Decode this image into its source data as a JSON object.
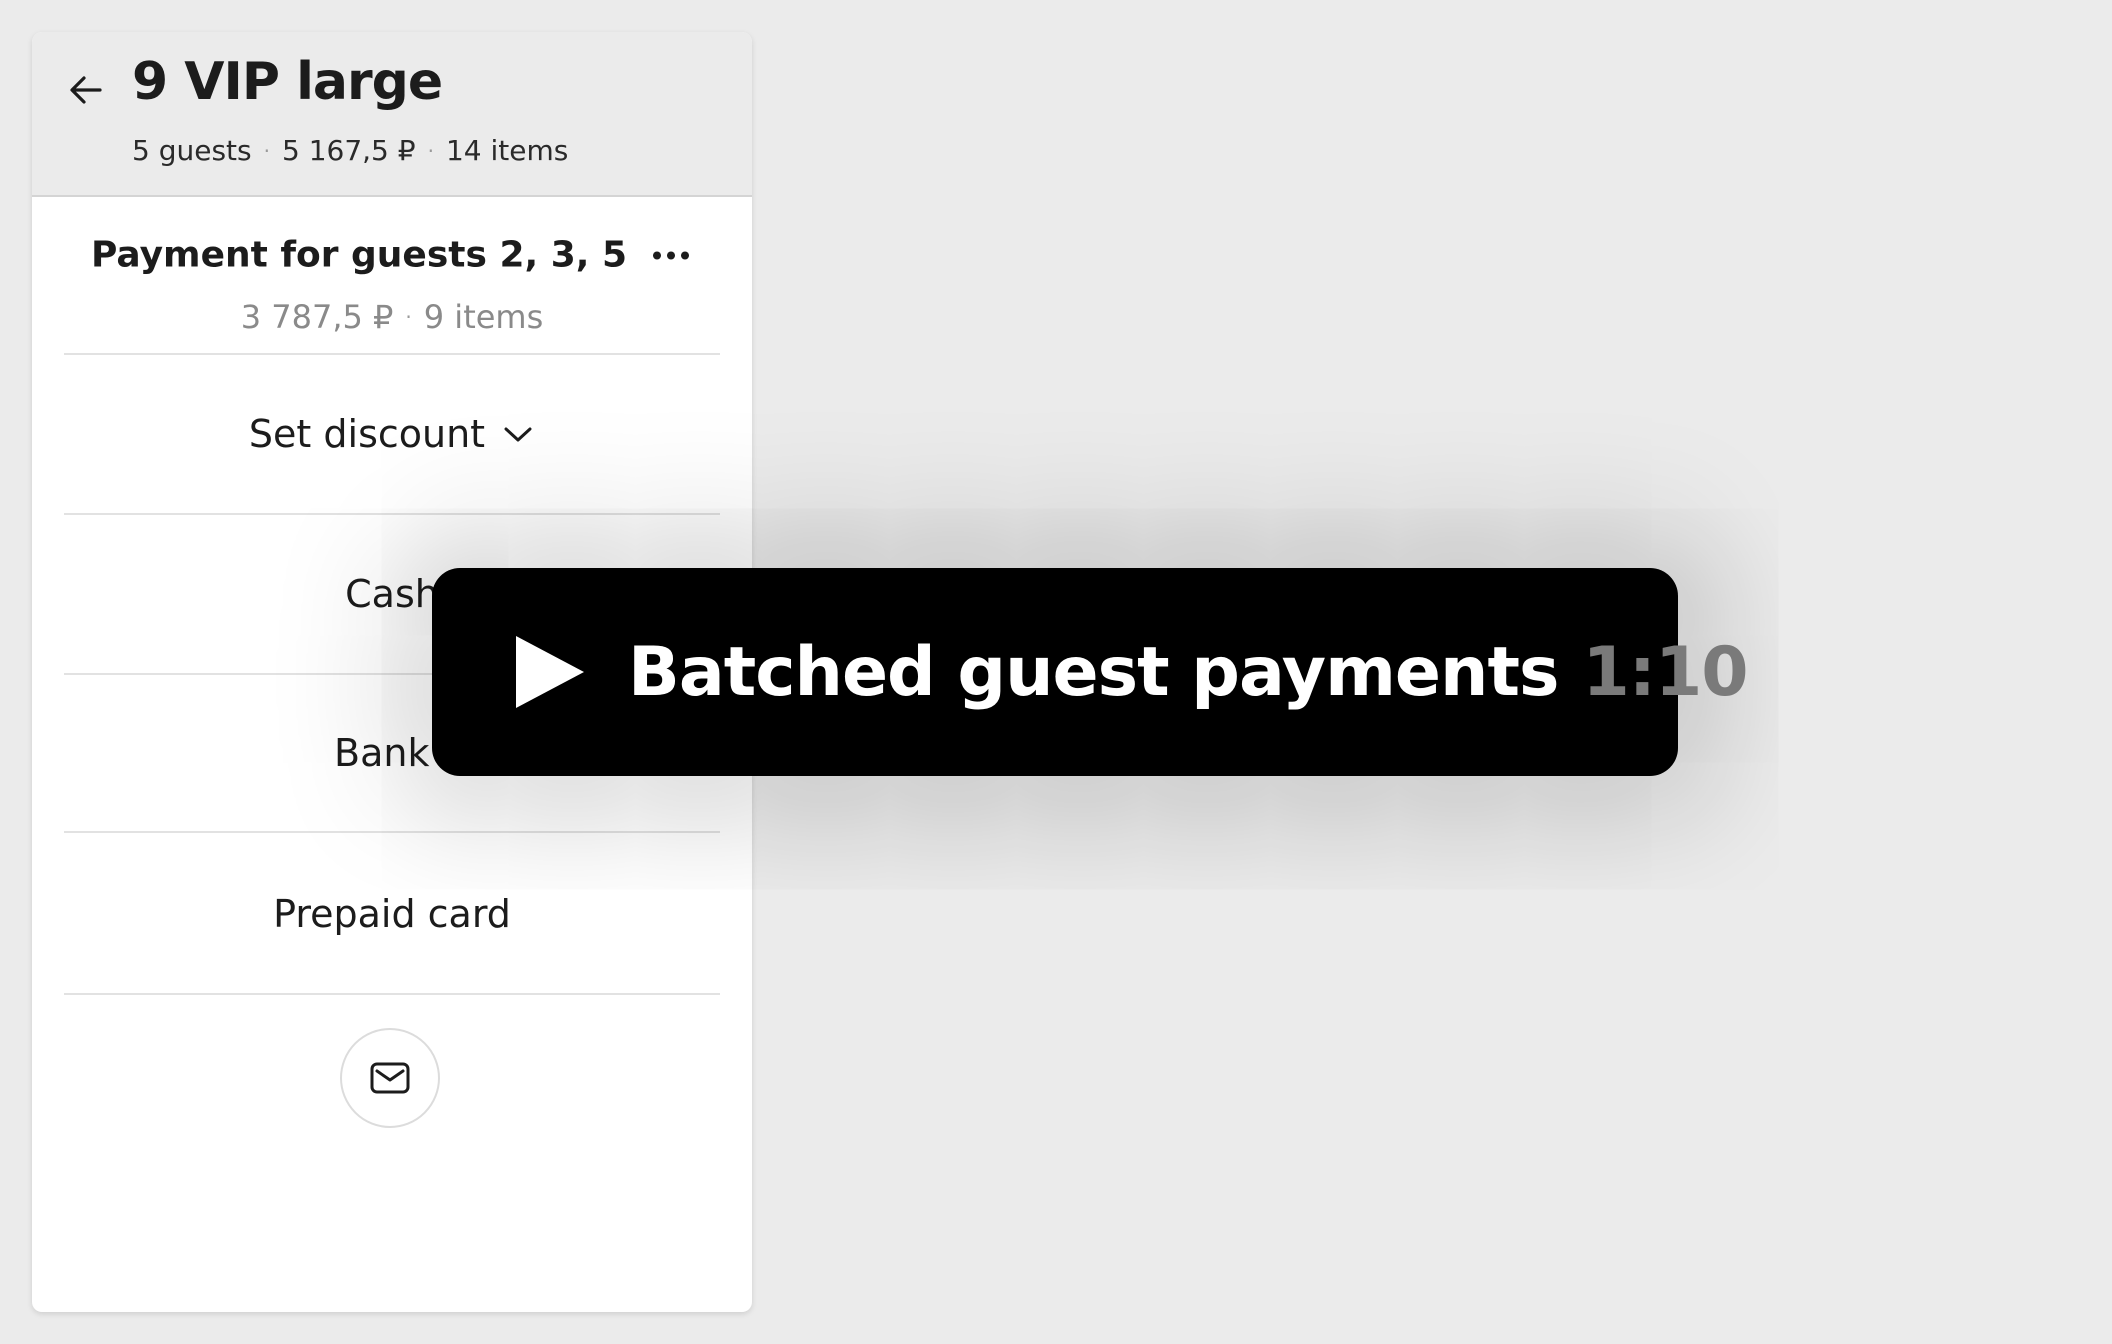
{
  "header": {
    "title": "9 VIP large",
    "guests": "5 guests",
    "total": "5 167,5 ₽",
    "items": "14 items",
    "separator": "·"
  },
  "subpayment": {
    "title": "Payment for guests 2, 3, 5",
    "amount": "3 787,5 ₽",
    "items": "9 items",
    "separator": "·"
  },
  "actions": {
    "discount_label": "Set discount",
    "cash_label": "Cash",
    "bank_card_label": "Bank ca",
    "prepaid_card_label": "Prepaid card"
  },
  "video": {
    "title": "Batched guest payments",
    "duration": "1:10"
  },
  "icons": {
    "back": "arrow-left-icon",
    "more": "more-horizontal-icon",
    "chevron": "chevron-down-icon",
    "mail": "mail-icon",
    "play": "play-icon"
  },
  "colors": {
    "background": "#ebebeb",
    "panel": "#ffffff",
    "header": "#ebebeb",
    "text": "#1c1c1c",
    "muted_text": "#8a8a8a",
    "video_bg": "#000000",
    "video_duration": "#7a7a7a"
  }
}
